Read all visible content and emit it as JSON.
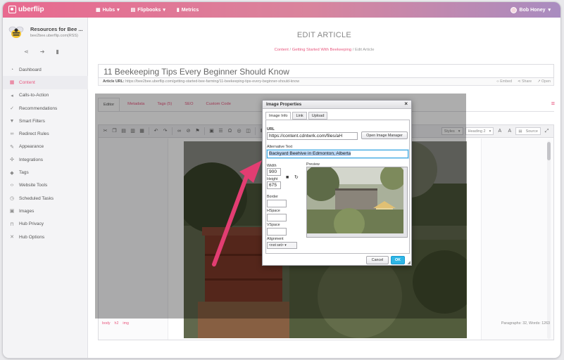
{
  "brand": {
    "name": "uberflip",
    "accent": "#e8587f"
  },
  "topnav": {
    "items": [
      {
        "label": "Hubs",
        "icon": "grid-icon",
        "dropdown": true
      },
      {
        "label": "Flipbooks",
        "icon": "book-icon",
        "dropdown": true
      },
      {
        "label": "Metrics",
        "icon": "bar-chart-icon",
        "dropdown": false
      }
    ],
    "user": "Bob Honey"
  },
  "sidebar": {
    "hub_name": "Resources for Bee ...",
    "hub_url": "bee2bee.uberflip.com(RSS)",
    "items": [
      {
        "label": "Dashboard",
        "icon": "dashboard-icon"
      },
      {
        "label": "Content",
        "icon": "content-grid-icon",
        "active": true
      },
      {
        "label": "Calls-to-Action",
        "icon": "megaphone-icon"
      },
      {
        "label": "Recommendations",
        "icon": "thumbs-up-icon"
      },
      {
        "label": "Smart Filters",
        "icon": "filter-icon"
      },
      {
        "label": "Redirect Rules",
        "icon": "link-icon"
      },
      {
        "label": "Appearance",
        "icon": "brush-icon"
      },
      {
        "label": "Integrations",
        "icon": "puzzle-icon"
      },
      {
        "label": "Tags",
        "icon": "tag-icon"
      },
      {
        "label": "Website Tools",
        "icon": "code-icon"
      },
      {
        "label": "Scheduled Tasks",
        "icon": "clock-icon"
      },
      {
        "label": "Images",
        "icon": "image-icon"
      },
      {
        "label": "Hub Privacy",
        "icon": "lock-icon"
      },
      {
        "label": "Hub Options",
        "icon": "wrench-icon"
      }
    ]
  },
  "page": {
    "title": "EDIT ARTICLE",
    "breadcrumb": [
      "Content",
      "Getting Started With Beekeeping",
      "Edit Article"
    ],
    "article_title": "11 Beekeeping Tips Every Beginner Should Know",
    "article_url_label": "Article URL:",
    "article_url": "https://bee2bee.uberflip.com/getting-started-bee-farming/11-beekeeping-tips-every-beginner-should-know",
    "url_actions": [
      "Embed",
      "Share",
      "Open"
    ],
    "tabs": [
      "Editor",
      "Metadata",
      "Tags (5)",
      "SEO",
      "Custom Code"
    ]
  },
  "editor": {
    "styles_label": "Styles",
    "heading_label": "Heading 2",
    "source_label": "Source",
    "path": [
      "body",
      "h2",
      "img"
    ],
    "counts": "Paragraphs: 32, Words: 1263"
  },
  "dialog": {
    "title": "Image Properties",
    "tabs": [
      "Image Info",
      "Link",
      "Upload"
    ],
    "url_label": "URL",
    "url_value": "https://content.cdntwrk.com/files/aH",
    "open_manager": "Open Image Manager",
    "alt_label": "Alternative Text",
    "alt_value": "Backyard Beehive in Edmonton, Alberta",
    "width_label": "Width",
    "width_value": "900",
    "height_label": "Height",
    "height_value": "675",
    "border_label": "Border",
    "hspace_label": "HSpace",
    "vspace_label": "VSpace",
    "alignment_label": "Alignment",
    "alignment_value": "<not set>",
    "preview_label": "Preview",
    "cancel": "Cancel",
    "ok": "OK"
  }
}
